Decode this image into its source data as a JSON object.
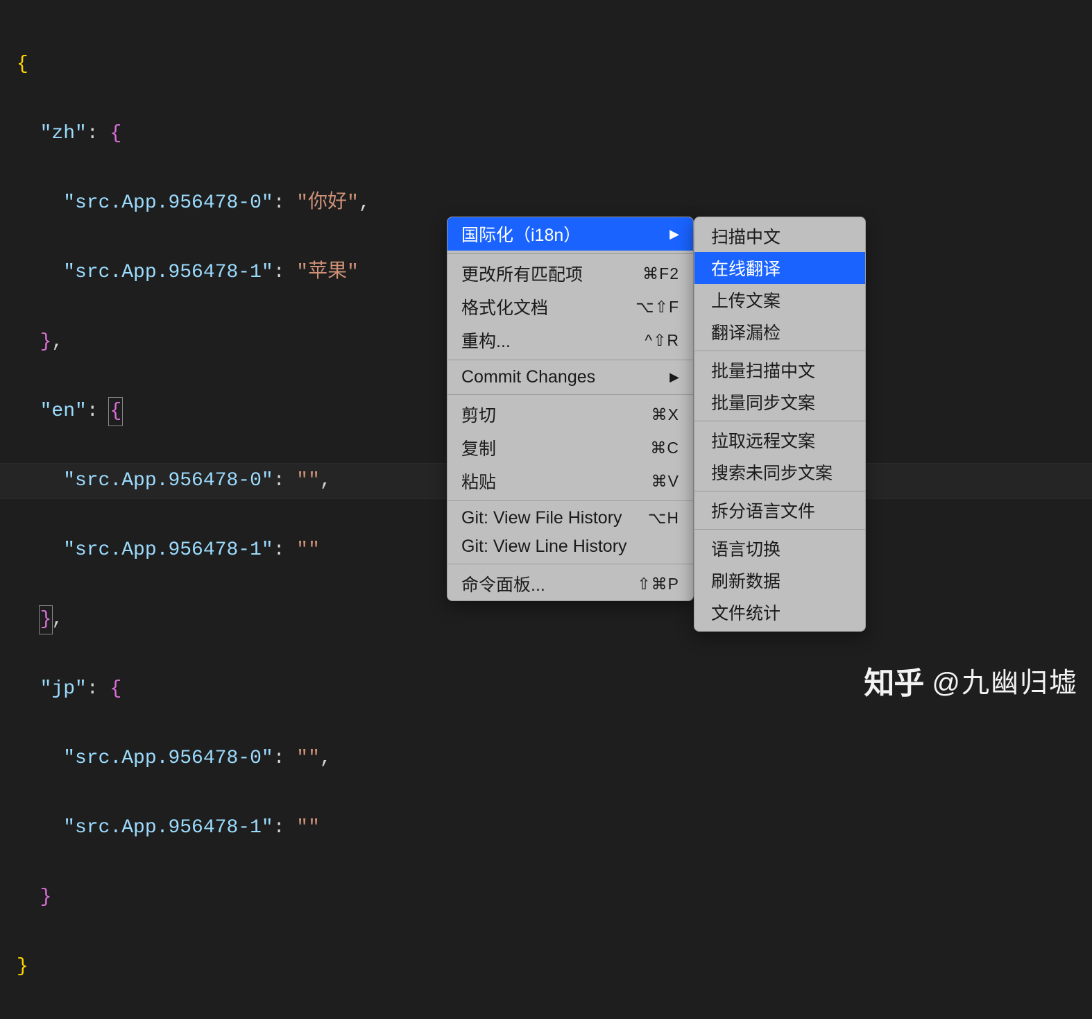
{
  "code": {
    "langs": [
      "zh",
      "en",
      "jp"
    ],
    "keys": [
      "src.App.956478-0",
      "src.App.956478-1"
    ],
    "values": {
      "zh": [
        "你好",
        "苹果"
      ],
      "en": [
        "",
        ""
      ],
      "jp": [
        "",
        ""
      ]
    }
  },
  "menu": {
    "items": [
      {
        "label": "国际化（i18n）",
        "arrow": "▶",
        "highlighted": true
      },
      {
        "sep": true
      },
      {
        "label": "更改所有匹配项",
        "shortcut": "⌘F2"
      },
      {
        "label": "格式化文档",
        "shortcut": "⌥⇧F"
      },
      {
        "label": "重构...",
        "shortcut": "^⇧R"
      },
      {
        "sep": true
      },
      {
        "label": "Commit Changes",
        "arrow": "▶"
      },
      {
        "sep": true
      },
      {
        "label": "剪切",
        "shortcut": "⌘X"
      },
      {
        "label": "复制",
        "shortcut": "⌘C"
      },
      {
        "label": "粘贴",
        "shortcut": "⌘V"
      },
      {
        "sep": true
      },
      {
        "label": "Git: View File History",
        "shortcut": "⌥H"
      },
      {
        "label": "Git: View Line History"
      },
      {
        "sep": true
      },
      {
        "label": "命令面板...",
        "shortcut": "⇧⌘P"
      }
    ]
  },
  "submenu": {
    "groups": [
      [
        {
          "label": "扫描中文"
        },
        {
          "label": "在线翻译",
          "highlighted": true
        },
        {
          "label": "上传文案"
        },
        {
          "label": "翻译漏检"
        }
      ],
      [
        {
          "label": "批量扫描中文"
        },
        {
          "label": "批量同步文案"
        }
      ],
      [
        {
          "label": "拉取远程文案"
        },
        {
          "label": "搜索未同步文案"
        }
      ],
      [
        {
          "label": "拆分语言文件"
        }
      ],
      [
        {
          "label": "语言切换"
        },
        {
          "label": "刷新数据"
        },
        {
          "label": "文件统计"
        }
      ]
    ]
  },
  "watermark": {
    "logo": "知乎",
    "text": "@九幽归墟"
  }
}
